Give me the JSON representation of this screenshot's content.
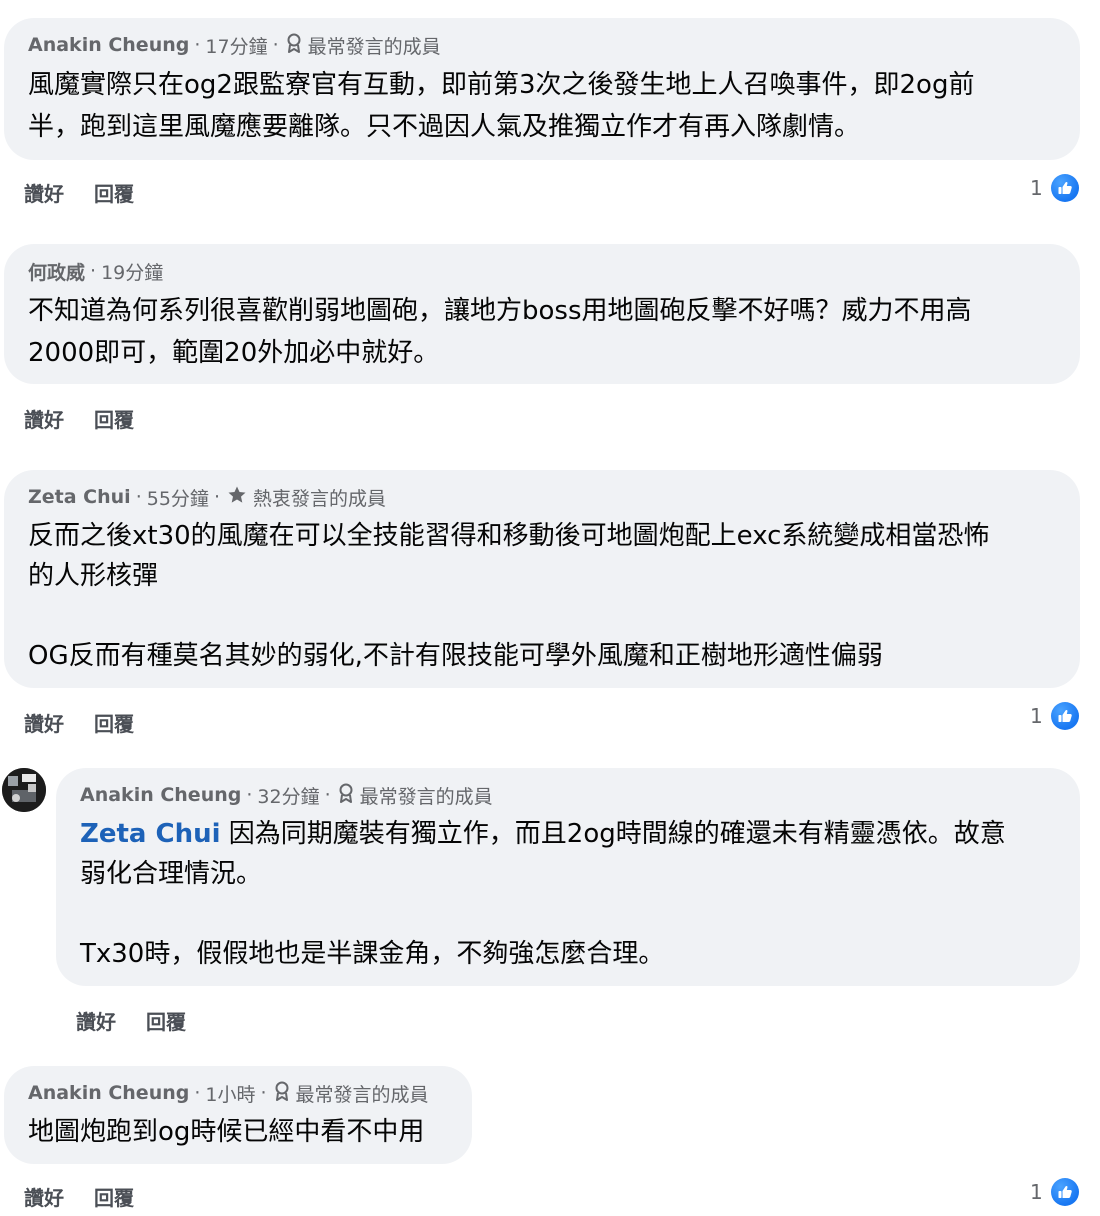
{
  "actions": {
    "like": "讚好",
    "reply": "回覆"
  },
  "comments": [
    {
      "author": "Anakin Cheung",
      "time": "17分鐘",
      "badge": "最常發言的成員",
      "badge_icon": "medal-icon",
      "text": "風魔實際只在og2跟監寮官有互動，即前第3次之後發生地上人召喚事件，即2og前\n半，跑到這里風魔應要離隊。只不過因人氣及推獨立作才有再入隊劇情。",
      "reactions": "1"
    },
    {
      "author": "何政威",
      "time": "19分鐘",
      "text": "不知道為何系列很喜歡削弱地圖砲，讓地方boss用地圖砲反擊不好嗎？威力不用高\n2000即可，範圍20外加必中就好。"
    },
    {
      "author": "Zeta Chui",
      "time": "55分鐘",
      "badge": "熱衷發言的成員",
      "badge_icon": "star-icon",
      "text": "反而之後xt30的風魔在可以全技能習得和移動後可地圖炮配上exc系統變成相當恐怖\n的人形核彈\n\nOG反而有種莫名其妙的弱化,不計有限技能可學外風魔和正樹地形適性偏弱",
      "reactions": "1"
    },
    {
      "author": "Anakin Cheung",
      "time": "32分鐘",
      "badge": "最常發言的成員",
      "badge_icon": "medal-icon",
      "mention": "Zeta Chui",
      "text": " 因為同期魔裝有獨立作，而且2og時間線的確還未有精靈憑依。故意\n弱化合理情況。\n\nTx30時，假假地也是半課金角，不夠強怎麼合理。"
    },
    {
      "author": "Anakin Cheung",
      "time": "1小時",
      "badge": "最常發言的成員",
      "badge_icon": "medal-icon",
      "text": "地圖炮跑到og時候已經中看不中用",
      "reactions": "1"
    }
  ]
}
